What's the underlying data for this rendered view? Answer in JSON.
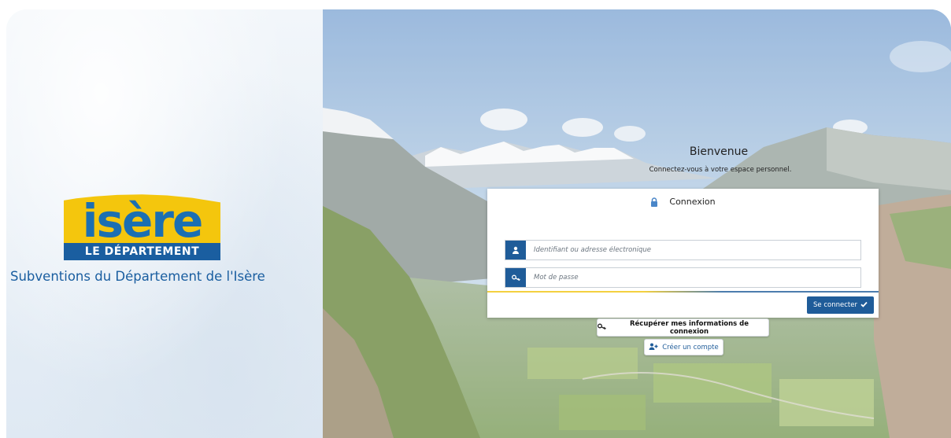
{
  "branding": {
    "logo_word": "isère",
    "logo_tagline": "LE DÉPARTEMENT",
    "site_title": "Subventions du Département de l'Isère",
    "colors": {
      "yellow": "#f4c60d",
      "blue": "#1a5ea0",
      "accent": "#1f5c99"
    }
  },
  "welcome": {
    "title": "Bienvenue",
    "subtitle": "Connectez-vous à votre espace personnel."
  },
  "login": {
    "title": "Connexion",
    "title_icon": "lock-icon",
    "username": {
      "placeholder": "Identifiant ou adresse électronique",
      "value": "",
      "icon": "user-icon"
    },
    "password": {
      "placeholder": "Mot de passe",
      "value": "",
      "icon": "key-icon"
    },
    "submit_label": "Se connecter",
    "submit_icon": "check-icon"
  },
  "links": {
    "recover_label": "Récupérer mes informations de connexion",
    "recover_icon": "key-icon",
    "create_label": "Créer un compte",
    "create_icon": "user-plus-icon"
  }
}
